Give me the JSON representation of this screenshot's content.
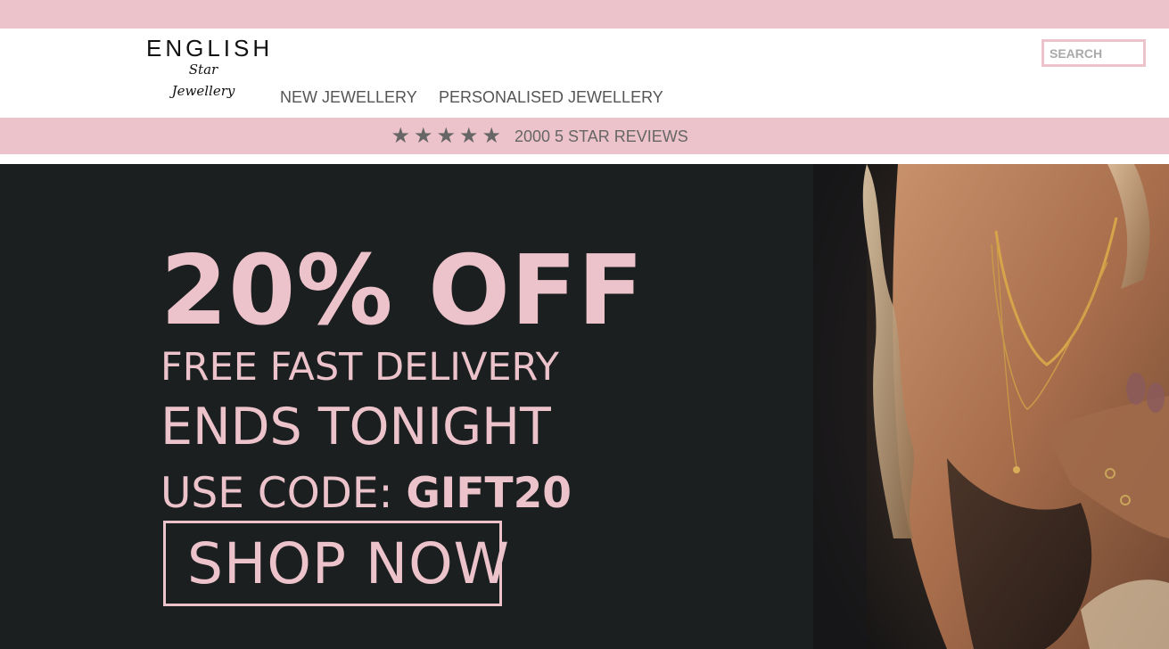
{
  "logo": {
    "main": "ENGLISH",
    "script": "Star Jewellery"
  },
  "search": {
    "placeholder": "SEARCH"
  },
  "nav": {
    "items": [
      {
        "label": "NEW JEWELLERY"
      },
      {
        "label": "PERSONALISED JEWELLERY"
      }
    ]
  },
  "reviews": {
    "rating_stars": 5,
    "text": "2000 5 STAR REVIEWS"
  },
  "hero": {
    "headline": "20% OFF",
    "line1": "FREE FAST DELIVERY",
    "line2": "ENDS TONIGHT",
    "code_prefix": "USE CODE: ",
    "code": "GIFT20",
    "cta": "SHOP NOW"
  },
  "colors": {
    "accent_pink": "#ecc3cb",
    "hero_bg": "#1b1f1f",
    "nav_text": "#555555"
  }
}
